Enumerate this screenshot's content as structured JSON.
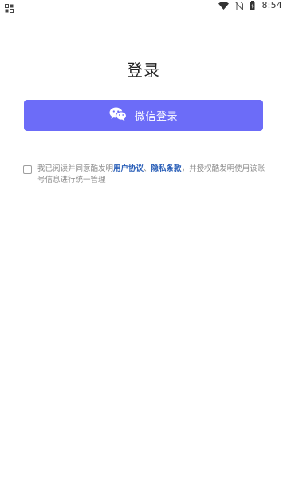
{
  "status_bar": {
    "time": "8:54",
    "icons": [
      "notification-icon",
      "wifi-icon",
      "no-sim-icon",
      "battery-icon"
    ]
  },
  "page": {
    "title": "登录"
  },
  "login_button": {
    "label": "微信登录",
    "icon": "wechat-icon",
    "color": "#6c6cf8"
  },
  "agreement": {
    "checked": false,
    "text_before": "我已阅读并同意酷发明",
    "user_agreement_link": "用户协议",
    "separator": "、",
    "privacy_link": "隐私条款",
    "text_after": "，并授权酷发明使用该账号信息进行统一管理",
    "link_color": "#2a5fb8"
  }
}
